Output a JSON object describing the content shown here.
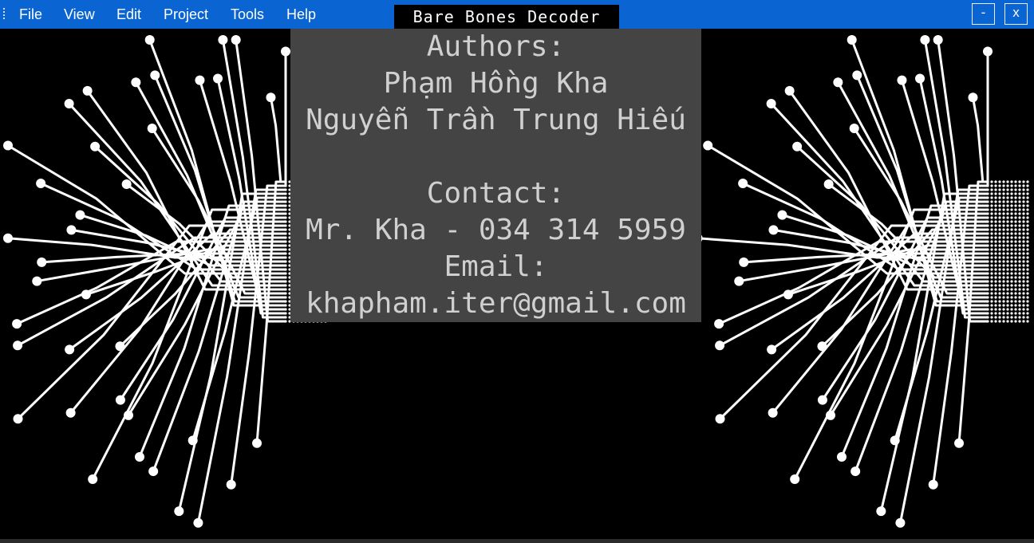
{
  "menubar": {
    "items": [
      "File",
      "View",
      "Edit",
      "Project",
      "Tools",
      "Help"
    ]
  },
  "window": {
    "title": "Bare Bones Decoder",
    "minimize_label": "-",
    "close_label": "x"
  },
  "credits": {
    "authors_heading": "Authors:",
    "author_1": "Phạm Hồng Kha",
    "author_2": "Nguyễn Trần Trung Hiếu",
    "contact_heading": "Contact:",
    "phone": "Mr. Kha - 034 314 5959",
    "email_heading": "Email:",
    "email": "khapham.iter@gmail.com"
  },
  "background": {
    "icon": "circuit-brain-icon",
    "colors": {
      "trace": "#ffffff",
      "canvas": "#000000",
      "panel": "#444444",
      "accent": "#0a64d2"
    }
  }
}
